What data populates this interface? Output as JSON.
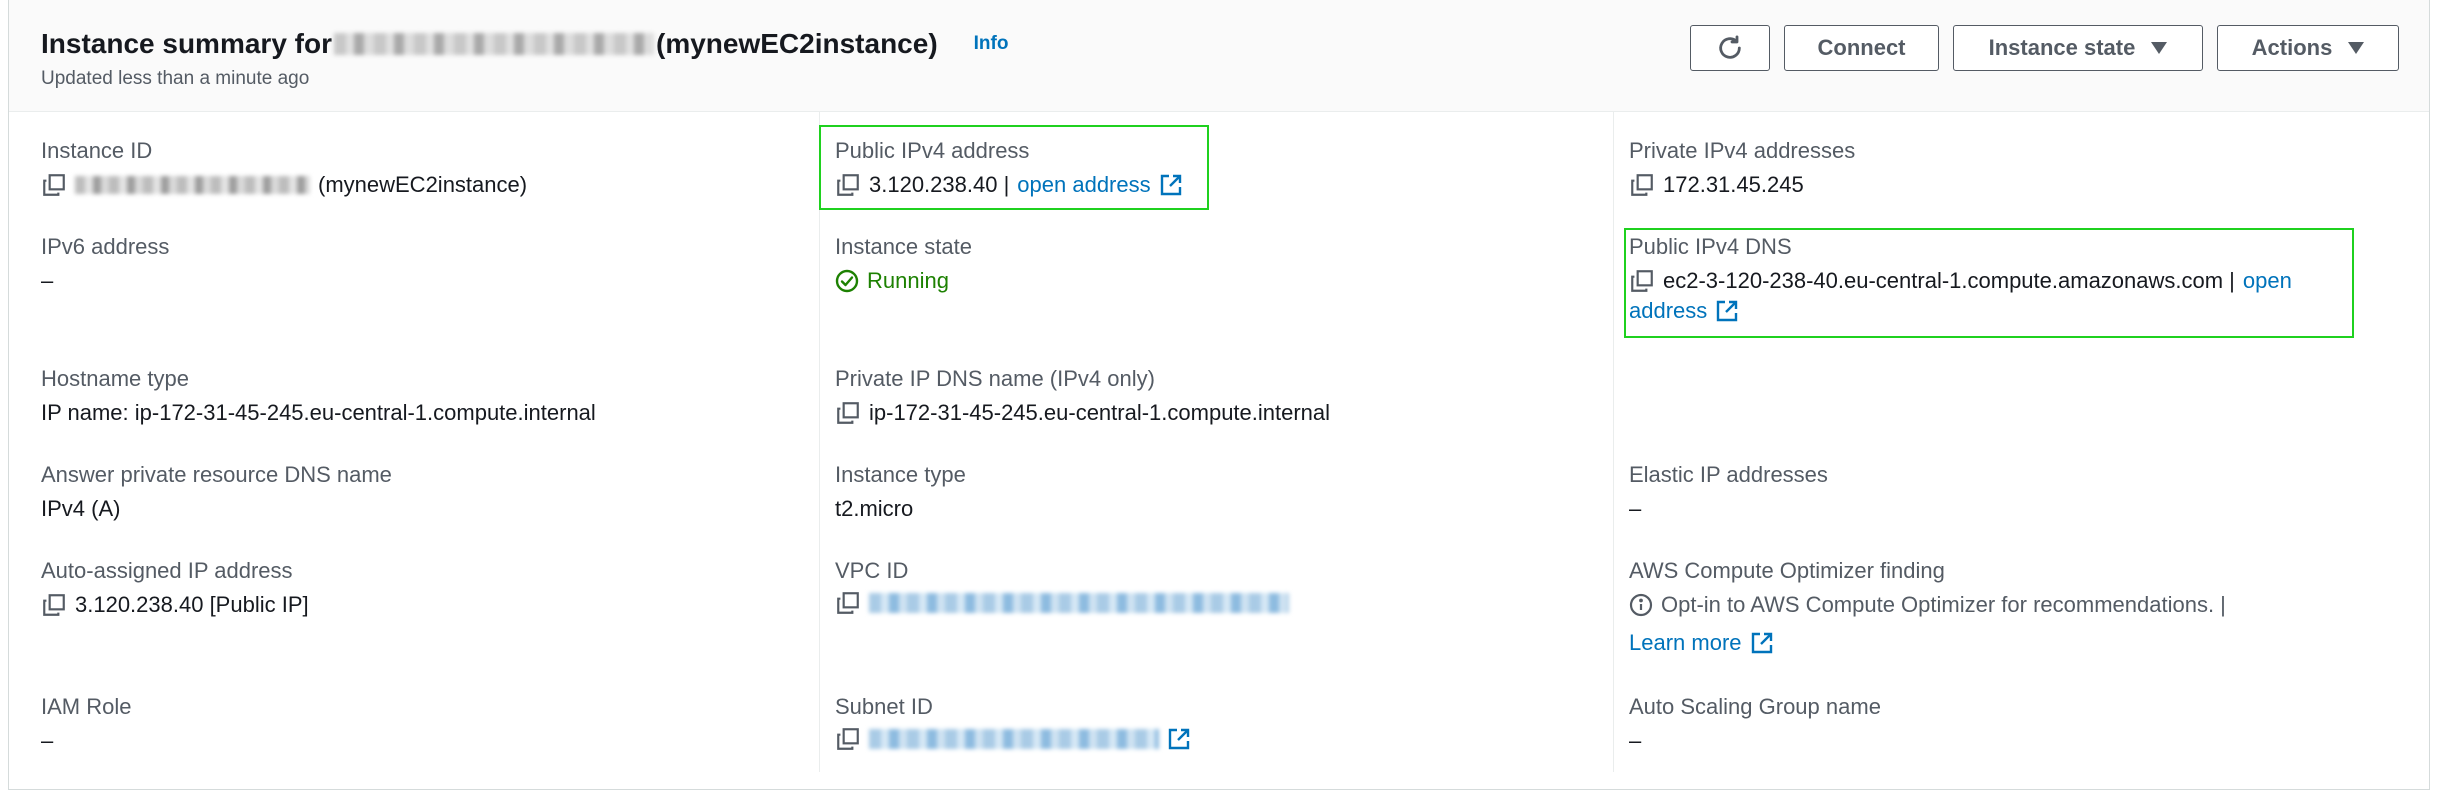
{
  "header": {
    "title_prefix": "Instance summary for",
    "title_suffix": "(mynewEC2instance)",
    "info": "Info",
    "updated": "Updated less than a minute ago"
  },
  "buttons": {
    "refresh": "refresh-icon",
    "connect": "Connect",
    "instance_state": "Instance state",
    "actions": "Actions"
  },
  "col1": {
    "instance_id": {
      "label": "Instance ID",
      "suffix": "(mynewEC2instance)"
    },
    "ipv6": {
      "label": "IPv6 address",
      "value": "–"
    },
    "hostname_type": {
      "label": "Hostname type",
      "value": "IP name: ip-172-31-45-245.eu-central-1.compute.internal"
    },
    "answer_dns": {
      "label": "Answer private resource DNS name",
      "value": "IPv4 (A)"
    },
    "auto_ip": {
      "label": "Auto-assigned IP address",
      "value": "3.120.238.40 [Public IP]"
    },
    "iam_role": {
      "label": "IAM Role",
      "value": "–"
    }
  },
  "col2": {
    "public_ipv4": {
      "label": "Public IPv4 address",
      "value": "3.120.238.40 |",
      "link": "open address"
    },
    "instance_state": {
      "label": "Instance state",
      "value": "Running"
    },
    "private_dns": {
      "label": "Private IP DNS name (IPv4 only)",
      "value": "ip-172-31-45-245.eu-central-1.compute.internal"
    },
    "instance_type": {
      "label": "Instance type",
      "value": "t2.micro"
    },
    "vpc_id": {
      "label": "VPC ID"
    },
    "subnet_id": {
      "label": "Subnet ID"
    }
  },
  "col3": {
    "private_ipv4": {
      "label": "Private IPv4 addresses",
      "value": "172.31.45.245"
    },
    "public_dns": {
      "label": "Public IPv4 DNS",
      "value": "ec2-3-120-238-40.eu-central-1.compute.amazonaws.com |",
      "link_1": "open",
      "link_2": "address"
    },
    "elastic_ip": {
      "label": "Elastic IP addresses",
      "value": "–"
    },
    "optimizer": {
      "label": "AWS Compute Optimizer finding",
      "value": "Opt-in to AWS Compute Optimizer for recommendations. |",
      "link": "Learn more"
    },
    "asg": {
      "label": "Auto Scaling Group name",
      "value": "–"
    }
  },
  "colors": {
    "link": "#0073bb",
    "running": "#1d8102",
    "highlight": "#1fd11f",
    "label": "#545b64"
  }
}
